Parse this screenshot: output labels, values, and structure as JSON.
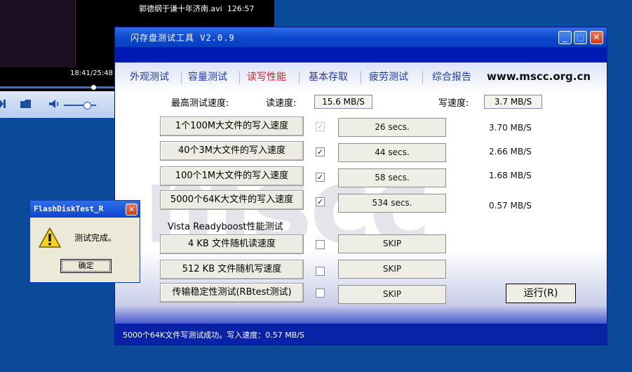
{
  "player": {
    "file_title": "郭德纲于谦十年济南.avi",
    "file_duration": "126:57",
    "elapsed": "18:41/25:48",
    "icons": [
      "next-icon",
      "folder-icon",
      "volume-icon"
    ]
  },
  "window": {
    "title": "闪存盘测试工具  V2.0.9",
    "minimize": "_",
    "maximize": "□",
    "close": "✕"
  },
  "tabs": [
    {
      "label": "外观测试",
      "active": false
    },
    {
      "label": "容量测试",
      "active": false
    },
    {
      "label": "读写性能",
      "active": true
    },
    {
      "label": "基本存取",
      "active": false
    },
    {
      "label": "疲劳测试",
      "active": false
    },
    {
      "label": "综合报告",
      "active": false
    }
  ],
  "site": "www.mscc.org.cn",
  "watermark": "mscc",
  "max_speed": {
    "label": "最高测试速度:",
    "read_label": "读速度:",
    "read_value": "15.6 MB/S",
    "write_label": "写速度:",
    "write_value": "3.7 MB/S"
  },
  "tests": [
    {
      "label": "1个100M大文件的写入速度",
      "checked": true,
      "disabled": true,
      "time": "26 secs.",
      "speed": "3.70 MB/S"
    },
    {
      "label": "40个3M大文件的写入速度",
      "checked": true,
      "disabled": false,
      "time": "44 secs.",
      "speed": "2.66 MB/S"
    },
    {
      "label": "100个1M大文件的写入速度",
      "checked": true,
      "disabled": false,
      "time": "58 secs.",
      "speed": "1.68 MB/S"
    },
    {
      "label": "5000个64K大文件的写入速度",
      "checked": true,
      "disabled": false,
      "time": "534 secs.",
      "speed": "0.57 MB/S"
    }
  ],
  "readyboost_label": "Vista Readyboost性能测试",
  "readyboost_tests": [
    {
      "label": "4 KB 文件随机读速度",
      "checked": false,
      "result": "SKIP"
    },
    {
      "label": "512 KB 文件随机写速度",
      "checked": false,
      "result": "SKIP"
    },
    {
      "label": "传输稳定性测试(RBtest测试)",
      "checked": false,
      "result": "SKIP"
    }
  ],
  "run_button": "运行(R)",
  "status_message": "5000个64K文件写测试成功。写入速度：0.57 MB/S",
  "msgbox": {
    "title": "FlashDiskTest_R",
    "close": "✕",
    "message": "测试完成。",
    "ok_label": "确定",
    "icon": "warning-icon"
  },
  "colors": {
    "desktop": "#0b4a98",
    "titlebar": "#0b47cf",
    "active_tab": "#d41e1e",
    "tab": "#1b3caa"
  }
}
